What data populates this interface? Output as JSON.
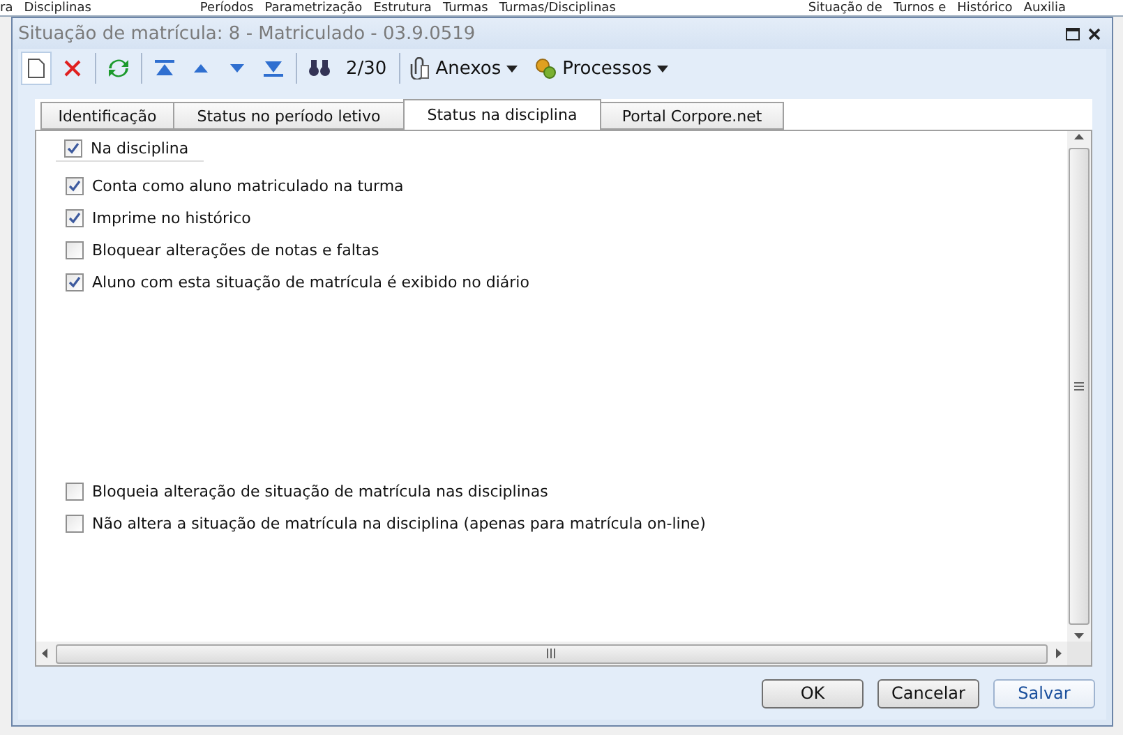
{
  "background_menu": [
    "ra",
    "Disciplinas",
    "Períodos",
    "Parametrização",
    "Estrutura",
    "Turmas",
    "Turmas/Disciplinas",
    "Situação de",
    "Turnos e",
    "Histórico",
    "Auxilia"
  ],
  "window": {
    "title": "Situação de matrícula: 8 - Matriculado - 03.9.0519"
  },
  "toolbar": {
    "counter": "2/30",
    "menus": [
      "Anexos",
      "Processos"
    ]
  },
  "tabs": [
    {
      "label": "Identificação",
      "selected": false
    },
    {
      "label": "Status no período letivo",
      "selected": false
    },
    {
      "label": "Status na disciplina",
      "selected": true
    },
    {
      "label": "Portal Corpore.net",
      "selected": false
    }
  ],
  "group": {
    "label": "Na disciplina",
    "checked": true
  },
  "options": [
    [
      {
        "label": "Conta como aluno matriculado na turma",
        "checked": true
      },
      {
        "label": "Imprime no histórico",
        "checked": true
      },
      {
        "label": "Bloquear alterações de notas e faltas",
        "checked": false
      },
      {
        "label": "Aluno com esta situação de matrícula é exibido no diário",
        "checked": true
      }
    ],
    [
      {
        "label": "Bloqueia alteração de situação de matrícula nas disciplinas",
        "checked": false
      },
      {
        "label": "Não altera a situação de matrícula na disciplina (apenas para matrícula on-line)",
        "checked": false
      }
    ]
  ],
  "buttons": [
    {
      "label": "OK",
      "kind": "normal"
    },
    {
      "label": "Cancelar",
      "kind": "normal"
    },
    {
      "label": "Salvar",
      "kind": "accent"
    }
  ]
}
